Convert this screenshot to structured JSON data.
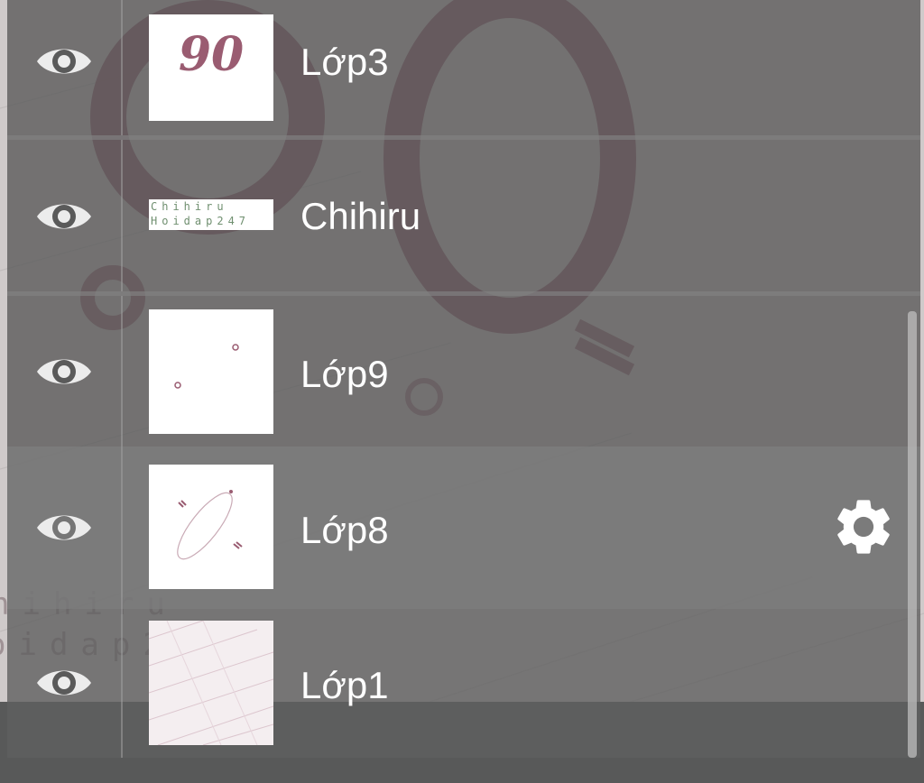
{
  "layers": [
    {
      "name": "Lớp3",
      "thumb_text": "90"
    },
    {
      "name": "Chihiru",
      "thumb_lines": [
        "Chihiru",
        "Hoidap247"
      ]
    },
    {
      "name": "Lớp9"
    },
    {
      "name": "Lớp8",
      "selected": true
    },
    {
      "name": "Lớp1"
    }
  ],
  "background_text": [
    "hihiru",
    "oidap247"
  ],
  "icons": {
    "visibility": "eye-icon",
    "settings": "gear-icon"
  },
  "colors": {
    "layer_bg": "#585858",
    "selected_bg": "#767676",
    "bottom_bar": "#585959",
    "brand_pink": "#9a5c71",
    "text": "#ffffff"
  }
}
